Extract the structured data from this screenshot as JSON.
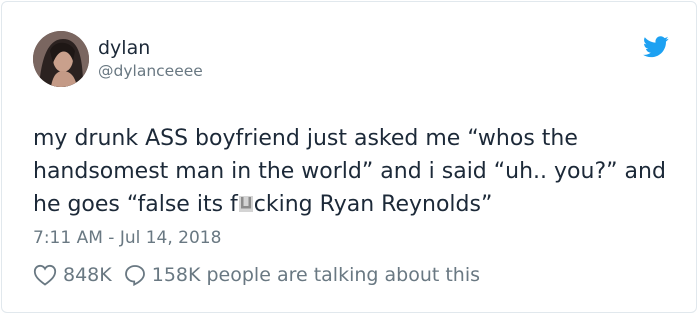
{
  "tweet": {
    "author_name": "dylan",
    "author_handle": "@dylanceeee",
    "text_before_censor": "my drunk ASS boyfriend just asked me “whos the handsomest man in the world” and i said “uh.. you?” and he goes “false its f",
    "text_after_censor": "cking Ryan Reynolds”",
    "timestamp": "7:11 AM - Jul 14, 2018",
    "likes_count": "848K",
    "replies_text": "158K people are talking about this",
    "brand_color": "#1da1f2",
    "icons": {
      "avatar": "avatar-photo",
      "brand": "twitter-bird-icon",
      "like": "heart-icon",
      "reply": "speech-bubble-icon",
      "censor": "censor-block-icon"
    }
  }
}
